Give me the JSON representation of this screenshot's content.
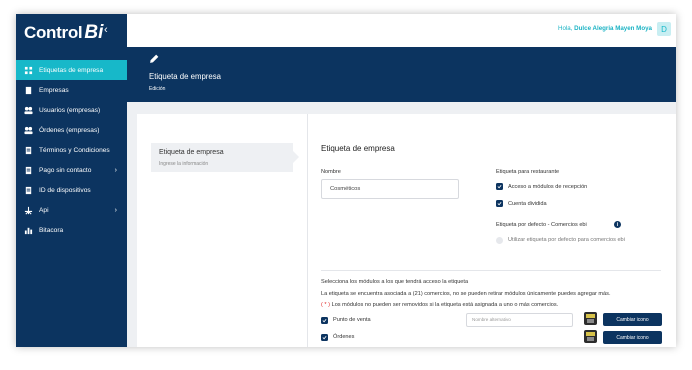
{
  "brand": {
    "name": "Control",
    "bi": "Bi",
    "collapse_icon": "chevron-left-icon"
  },
  "sidebar": {
    "items": [
      {
        "label": "Etiquetas de empresa",
        "icon": "tags-icon",
        "active": true
      },
      {
        "label": "Empresas",
        "icon": "building-icon"
      },
      {
        "label": "Usuarios (empresas)",
        "icon": "users-icon"
      },
      {
        "label": "Órdenes (empresas)",
        "icon": "users-icon"
      },
      {
        "label": "Términos y Condiciones",
        "icon": "document-icon"
      },
      {
        "label": "Pago sin contacto",
        "icon": "document-icon",
        "chevron": true
      },
      {
        "label": "ID de dispositivos",
        "icon": "document-icon"
      },
      {
        "label": "Api",
        "icon": "api-icon",
        "chevron": true
      },
      {
        "label": "Bitacora",
        "icon": "chart-icon"
      }
    ]
  },
  "topbar": {
    "greeting": "Hola,",
    "user": "Dulce Alegria Mayen Moya",
    "avatar": "D"
  },
  "banner": {
    "title": "Etiqueta de empresa",
    "subtitle": "Edición"
  },
  "stepper": {
    "title": "Etiqueta de empresa",
    "subtitle": "Ingrese la información"
  },
  "form": {
    "section_title": "Etiqueta de empresa",
    "name_label": "Nombre",
    "name_value": "Cosméticos",
    "restaurant_label": "Etiqueta para restaurante",
    "opt_reception": "Acceso a módulos de recepción",
    "opt_split": "Cuenta dividida",
    "default_label": "Etiqueta por defecto - Comercios ebi",
    "opt_default": "Utilizar etiqueta por defecto para comercios ebi",
    "modules_title": "Selecciona los módulos a los que tendrá acceso la etiqueta",
    "modules_note": "La etiqueta se encuentra asociada a (21) comercios, no se pueden retirar módulos únicamente puedes agregar más.",
    "modules_warn_mark": "( * )",
    "modules_warn": "Los módulos no pueden ser removidos si la etiqueta está asignada a uno o más comercios.",
    "module_pos": "Punto de venta",
    "module_orders": "Órdenes",
    "alt_name_placeholder": "Nombre alternativo",
    "change_icon_label": "Cambiar icono"
  },
  "colors": {
    "navy": "#0c3460",
    "teal": "#17b8c9"
  }
}
